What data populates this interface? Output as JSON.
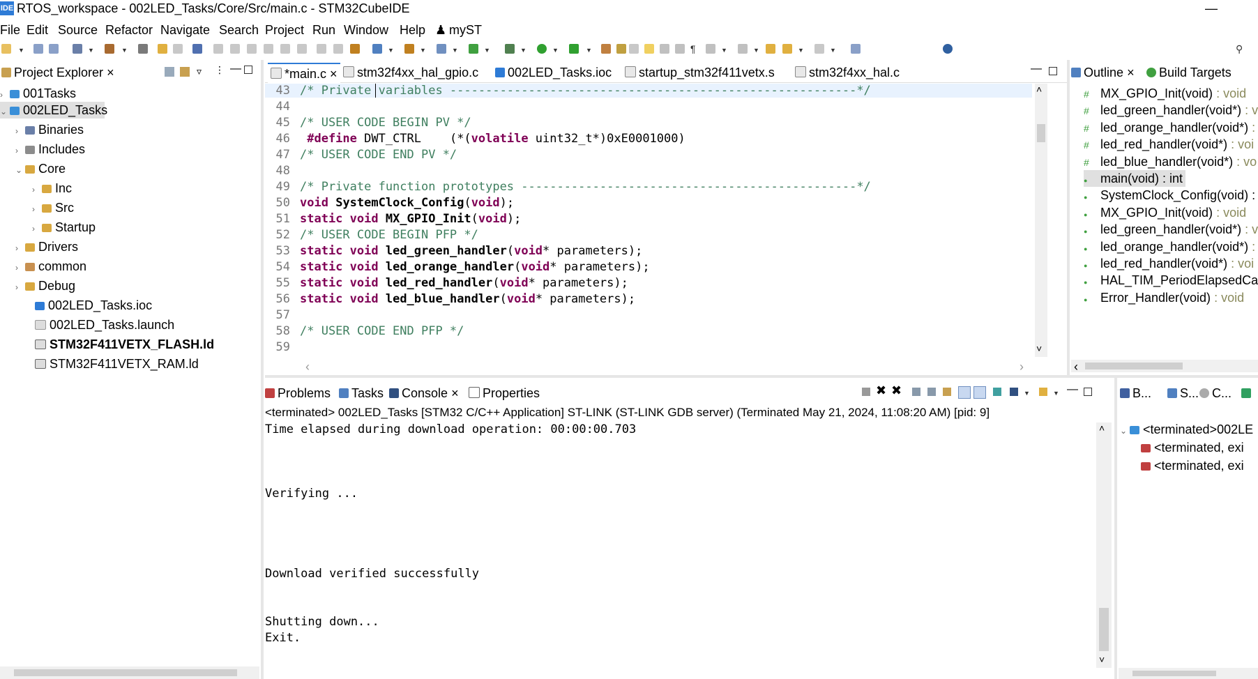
{
  "window": {
    "title": "RTOS_workspace - 002LED_Tasks/Core/Src/main.c - STM32CubeIDE",
    "app_logo": "IDE",
    "minimize": "—"
  },
  "menu": [
    "File",
    "Edit",
    "Source",
    "Refactor",
    "Navigate",
    "Search",
    "Project",
    "Run",
    "Window",
    "Help",
    "myST"
  ],
  "project_explorer": {
    "title": "Project Explorer",
    "items": [
      {
        "label": "001Tasks",
        "badge": "IDE"
      },
      {
        "label": "002LED_Tasks",
        "badge": "IDE"
      },
      {
        "label": "Binaries"
      },
      {
        "label": "Includes"
      },
      {
        "label": "Core"
      },
      {
        "label": "Inc"
      },
      {
        "label": "Src"
      },
      {
        "label": "Startup"
      },
      {
        "label": "Drivers"
      },
      {
        "label": "common"
      },
      {
        "label": "Debug"
      },
      {
        "label": "002LED_Tasks.ioc",
        "badge": "MX"
      },
      {
        "label": "002LED_Tasks.launch"
      },
      {
        "label": "STM32F411VETX_FLASH.ld"
      },
      {
        "label": "STM32F411VETX_RAM.ld"
      }
    ]
  },
  "editor": {
    "tabs": [
      {
        "label": "*main.c"
      },
      {
        "label": "stm32f4xx_hal_gpio.c"
      },
      {
        "label": "002LED_Tasks.ioc",
        "badge": "MX"
      },
      {
        "label": "startup_stm32f411vetx.s"
      },
      {
        "label": "stm32f4xx_hal.c"
      }
    ],
    "lines": [
      {
        "n": "43",
        "text": "/* Private variables ---------------------------------------------------------*/"
      },
      {
        "n": "44",
        "text": ""
      },
      {
        "n": "45",
        "text": "/* USER CODE BEGIN PV */"
      },
      {
        "n": "46",
        "pre": " #define ",
        "name": "DWT_CTRL",
        "mid": "    (*(",
        "kw2": "volatile",
        "post": " uint32_t*)0xE0001000)"
      },
      {
        "n": "47",
        "text": "/* USER CODE END PV */"
      },
      {
        "n": "48",
        "text": ""
      },
      {
        "n": "49",
        "text": "/* Private function prototypes -----------------------------------------------*/"
      },
      {
        "n": "50",
        "kw": "void",
        "fn": "SystemClock_Config",
        "args": "void",
        "rest": ");"
      },
      {
        "n": "51",
        "kw": "static void",
        "fn": "MX_GPIO_Init",
        "args": "void",
        "rest": ");"
      },
      {
        "n": "52",
        "text": "/* USER CODE BEGIN PFP */"
      },
      {
        "n": "53",
        "kw": "static void",
        "fn": "led_green_handler",
        "args": "void",
        "rest": "* parameters);"
      },
      {
        "n": "54",
        "kw": "static void",
        "fn": "led_orange_handler",
        "args": "void",
        "rest": "* parameters);"
      },
      {
        "n": "55",
        "kw": "static void",
        "fn": "led_red_handler",
        "args": "void",
        "rest": "* parameters);"
      },
      {
        "n": "56",
        "kw": "static void",
        "fn": "led_blue_handler",
        "args": "void",
        "rest": "* parameters);"
      },
      {
        "n": "57",
        "text": ""
      },
      {
        "n": "58",
        "text": "/* USER CODE END PFP */"
      },
      {
        "n": "59",
        "text": ""
      }
    ]
  },
  "outline": {
    "tabs": [
      {
        "label": "Outline"
      },
      {
        "label": "Build Targets"
      }
    ],
    "items": [
      {
        "name": "MX_GPIO_Init(void)",
        "type": " : void"
      },
      {
        "name": "led_green_handler(void*)",
        "type": " : v"
      },
      {
        "name": "led_orange_handler(void*)",
        "type": " :"
      },
      {
        "name": "led_red_handler(void*)",
        "type": " : voi"
      },
      {
        "name": "led_blue_handler(void*)",
        "type": " : vo"
      },
      {
        "name": "main(void) : int",
        "type": ""
      },
      {
        "name": "SystemClock_Config(void) :",
        "type": ""
      },
      {
        "name": "MX_GPIO_Init(void)",
        "type": " : void"
      },
      {
        "name": "led_green_handler(void*)",
        "type": " : v"
      },
      {
        "name": "led_orange_handler(void*)",
        "type": " :"
      },
      {
        "name": "led_red_handler(void*)",
        "type": " : voi"
      },
      {
        "name": "HAL_TIM_PeriodElapsedCall",
        "type": ""
      },
      {
        "name": "Error_Handler(void)",
        "type": " : void"
      }
    ]
  },
  "console": {
    "tabs": [
      {
        "label": "Problems"
      },
      {
        "label": "Tasks"
      },
      {
        "label": "Console"
      },
      {
        "label": "Properties"
      }
    ],
    "header": "<terminated> 002LED_Tasks [STM32 C/C++ Application] ST-LINK (ST-LINK GDB server) (Terminated May 21, 2024, 11:08:20 AM) [pid: 9]",
    "lines": [
      "Time elapsed during download operation: 00:00:00.703",
      "",
      "",
      "",
      "Verifying ...",
      "",
      "",
      "",
      "",
      "Download verified successfully",
      "",
      "",
      "Shutting down...",
      "Exit."
    ]
  },
  "debug_view": {
    "tabs": [
      {
        "label": "B..."
      },
      {
        "label": "S..."
      },
      {
        "label": "C..."
      }
    ],
    "items": [
      {
        "label": "<terminated>002LE"
      },
      {
        "label": "<terminated, exi"
      },
      {
        "label": "<terminated, exi"
      }
    ]
  },
  "colors": {
    "accent": "#2e7bd6",
    "comment": "#3f7f5f",
    "keyword": "#7f0055",
    "type": "#8a8a5c"
  }
}
